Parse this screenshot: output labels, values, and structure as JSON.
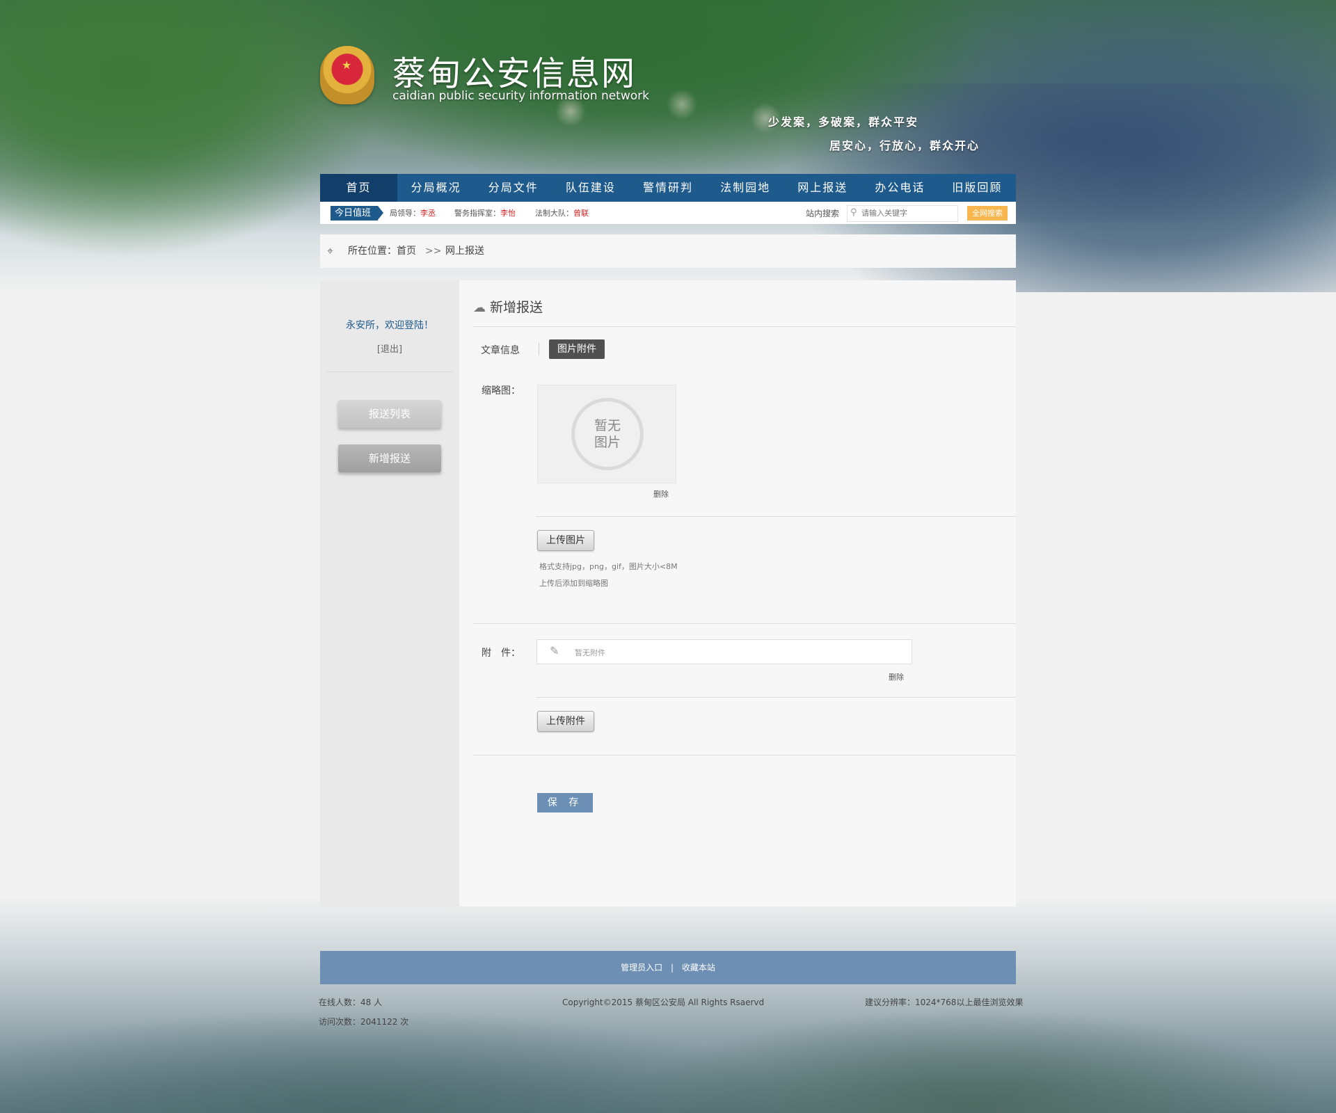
{
  "header": {
    "title": "蔡甸公安信息网",
    "subtitle": "caidian  public security information network",
    "slogan_line1": "少发案，多破案，群众平安",
    "slogan_line2": "居安心，行放心，群众开心"
  },
  "nav": {
    "items": [
      "首页",
      "分局概况",
      "分局文件",
      "队伍建设",
      "警情研判",
      "法制园地",
      "网上报送",
      "办公电话",
      "旧版回顾"
    ],
    "active_index": 0
  },
  "duty": {
    "badge": "今日值班",
    "leader_label": "局领导：",
    "leader_name": "李丞",
    "command_label": "警务指挥室：",
    "command_name": "李怡",
    "legal_label": "法制大队：",
    "legal_name": "曾联"
  },
  "search": {
    "label": "站内搜索",
    "placeholder": "请输入关键字",
    "button": "全网搜索"
  },
  "breadcrumb": {
    "label": "所在位置：",
    "home": "首页",
    "separator": ">>",
    "current": "网上报送"
  },
  "sidebar": {
    "welcome": "永安所，欢迎登陆！",
    "logout": "[退出]",
    "buttons": [
      "报送列表",
      "新增报送"
    ]
  },
  "content": {
    "title": "新增报送",
    "tabs": [
      "文章信息",
      "图片附件"
    ],
    "active_tab": 1,
    "thumbnail_label": "缩略图：",
    "no_image_line1": "暂无",
    "no_image_line2": "图片",
    "delete": "删除",
    "upload_image": "上传图片",
    "hint1": "格式支持jpg，png，gif，图片大小<8M",
    "hint2": "上传后添加到缩略图",
    "attachment_label": "附　件：",
    "attachment_placeholder": "暂无附件",
    "upload_attachment": "上传附件",
    "save": "保 存"
  },
  "footer": {
    "admin": "管理员入口",
    "divider": "|",
    "bookmark": "收藏本站",
    "online": "在线人数：48 人",
    "visits": "访问次数：2041122 次",
    "copyright": "Copyright©2015  蔡甸区公安局  All Rights Rsaervd",
    "resolution": "建议分辨率：1024*768以上最佳浏览效果"
  },
  "colors": {
    "nav": "#1e5a8c",
    "nav_active": "#123f6a",
    "search_button": "#f7b64e",
    "save_button": "#6b8fb5",
    "footer_bar": "#6c8fb3",
    "duty_name": "#dd2222"
  },
  "icons": {
    "emblem": "police-emblem",
    "breadcrumb": "location-pin-icon",
    "title": "cloud-upload-icon",
    "search": "search-icon",
    "attachment": "paperclip-icon"
  }
}
